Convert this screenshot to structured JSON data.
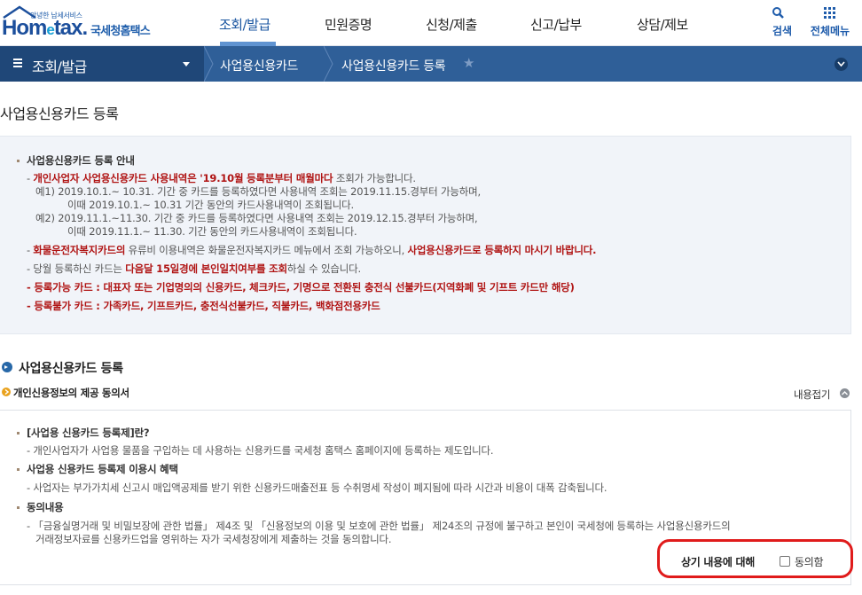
{
  "header": {
    "logo_small": "안녕한 납세서비스",
    "logo_brand_a": "Hom",
    "logo_brand_e": "e",
    "logo_brand_b": "tax.",
    "logo_nts": "국세청홈택스",
    "nav": [
      "조회/발급",
      "민원증명",
      "신청/제출",
      "신고/납부",
      "상담/제보"
    ],
    "active_nav": "조회/발급",
    "search_label": "검색",
    "allmenu_label": "전체메뉴"
  },
  "location": {
    "menu_title": "조회/발급",
    "crumbs": [
      "사업용신용카드",
      "사업용신용카드 등록"
    ]
  },
  "page_title": "사업용신용카드 등록",
  "notice": {
    "heading": "사업용신용카드 등록 안내",
    "l1_red": "개인사업자 사업용신용카드 사용내역은 '19.10월 등록분부터 매월마다",
    "l1_rest": " 조회가 가능합니다.",
    "l2": "예1) 2019.10.1.~ 10.31. 기간 중 카드를 등록하였다면 사용내역 조회는 2019.11.15.경부터 가능하며,",
    "l3": "이때 2019.10.1.~ 10.31 기간 동안의 카드사용내역이 조회됩니다.",
    "l4": "예2) 2019.11.1.~11.30. 기간 중 카드를 등록하였다면 사용내역 조회는 2019.12.15.경부터 가능하며,",
    "l5": "이때 2019.11.1.~ 11.30. 기간 동안의 카드사용내역이 조회됩니다.",
    "l6_red1": "화물운전자복지카드의",
    "l6_mid": " 유류비 이용내역은 화물운전자복지카드 메뉴에서 조회 가능하오니, ",
    "l6_red2": "사업용신용카드로 등록하지 마시기 바랍니다.",
    "l7_a": "당월 등록하신 카드는 ",
    "l7_red": "다음달 15일경에 본인일치여부를 조회",
    "l7_b": "하실 수 있습니다.",
    "l8": "등록가능 카드 : 대표자 또는 기업명의의 신용카드, 체크카드, 기명으로 전환된 충전식 선불카드(지역화폐 및 기프트 카드만 해당)",
    "l9": "등록불가 카드 : 가족카드, 기프트카드, 충전식선불카드, 직불카드, 백화점전용카드"
  },
  "section": {
    "title": "사업용신용카드 등록",
    "consent_title": "개인신용정보의 제공 동의서",
    "fold_label": "내용접기",
    "c1_head": "[사업용 신용카드 등록제]란?",
    "c1_body": "개인사업자가 사업용 물품을 구입하는 데 사용하는 신용카드를 국세청 홈택스 홈페이지에 등록하는 제도입니다.",
    "c2_head": "사업용 신용카드 등록제 이용시 혜택",
    "c2_body": "사업자는 부가가치세 신고시 매입액공제를 받기 위한 신용카드매출전표 등 수취명세 작성이 폐지됨에 따라 시간과 비용이 대폭 감축됩니다.",
    "c3_head": "동의내용",
    "c3_body1": "「금융실명거래 및 비밀보장에 관한 법률」 제4조 및 「신용정보의 이용 및 보호에 관한 법률」 제24조의 규정에 불구하고 본인이 국세청에 등록하는 사업용신용카드의",
    "c3_body2": "거래정보자료를 신용카드업을 영위하는 자가 국세청장에게 제출하는 것을 동의합니다.",
    "agree_prefix": "상기 내용에 대해",
    "agree_label": "동의함"
  },
  "colors": {
    "brand_blue": "#1c4f9c",
    "location_bar": "#2f5f98",
    "emphasis_red": "#b01414",
    "highlight_red": "#e01b1b"
  }
}
